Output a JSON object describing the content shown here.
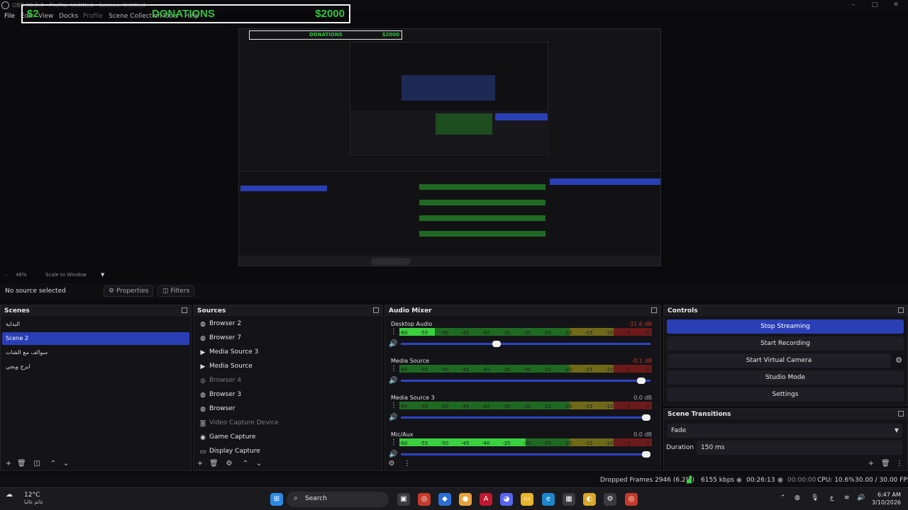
{
  "window": {
    "title": "OBS 30.2.3 - Profile: Untitled - Scenes: Untitled",
    "controls": [
      "–",
      "□",
      "✕"
    ]
  },
  "menu": [
    "File",
    "Edit",
    "View",
    "Docks",
    "Profile",
    "Scene Collection",
    "Tools",
    "Help"
  ],
  "donation_overlay": {
    "left_text": "$2",
    "label": "DONATIONS",
    "amount": "$2000"
  },
  "preview_bar": {
    "zoom": "46%",
    "scale_mode": "Scale to Window"
  },
  "context": {
    "no_source": "No source selected",
    "properties": "Properties",
    "filters": "Filters"
  },
  "scenes": {
    "title": "Scenes",
    "items": [
      {
        "label": "البداية",
        "active": false
      },
      {
        "label": "Scene 2",
        "active": true
      },
      {
        "label": "سوالف مع الشات",
        "active": false
      },
      {
        "label": "ايرج ويجي",
        "active": false
      }
    ]
  },
  "sources": {
    "title": "Sources",
    "items": [
      {
        "label": "Browser 2",
        "icon": "globe-icon",
        "visible": true
      },
      {
        "label": "Browser 7",
        "icon": "globe-icon",
        "visible": true
      },
      {
        "label": "Media Source 3",
        "icon": "play-icon",
        "visible": true
      },
      {
        "label": "Media Source",
        "icon": "play-icon",
        "visible": true
      },
      {
        "label": "Browser 4",
        "icon": "globe-icon",
        "visible": false
      },
      {
        "label": "Browser 3",
        "icon": "globe-icon",
        "visible": true
      },
      {
        "label": "Browser",
        "icon": "globe-icon",
        "visible": true
      },
      {
        "label": "Video Capture Device",
        "icon": "camera-icon",
        "visible": false
      },
      {
        "label": "Game Capture",
        "icon": "gamepad-icon",
        "visible": true
      },
      {
        "label": "Display Capture",
        "icon": "monitor-icon",
        "visible": true
      }
    ]
  },
  "audio_mixer": {
    "title": "Audio Mixer",
    "scale": [
      "-60",
      "-55",
      "-50",
      "-45",
      "-40",
      "-35",
      "-30",
      "-25",
      "-20",
      "-15",
      "-10",
      "-5",
      "0"
    ],
    "channels": [
      {
        "name": "Desktop Audio",
        "db": "-31.6 dB",
        "level": 0.14,
        "volume": 0.38,
        "hot": true
      },
      {
        "name": "Media Source",
        "db": "-0.1 dB",
        "level": 0.0,
        "volume": 0.98,
        "hot": true
      },
      {
        "name": "Media Source 3",
        "db": "0.0 dB",
        "level": 0.0,
        "volume": 1.0,
        "hot": false
      },
      {
        "name": "Mic/Aux",
        "db": "0.0 dB",
        "level": 0.5,
        "volume": 1.0,
        "hot": false
      }
    ]
  },
  "controls": {
    "title": "Controls",
    "stop_streaming": "Stop Streaming",
    "start_recording": "Start Recording",
    "start_virtual_camera": "Start Virtual Camera",
    "studio_mode": "Studio Mode",
    "settings": "Settings"
  },
  "scene_transitions": {
    "title": "Scene Transitions",
    "selected": "Fade",
    "duration_label": "Duration",
    "duration_value": "150 ms"
  },
  "status": {
    "dropped_frames": "Dropped Frames 2946 (6.2%)",
    "bitrate": "6155 kbps",
    "stream_time": "00:26:13",
    "record_time": "00:00:00",
    "cpu": "CPU: 10.6%",
    "fps": "30.00 / 30.00 FPS"
  },
  "taskbar": {
    "weather_temp": "12°C",
    "weather_text": "غائم غالبا",
    "search": "Search",
    "time": "6:47 AM",
    "date": "3/10/2026",
    "lang": "ع"
  }
}
